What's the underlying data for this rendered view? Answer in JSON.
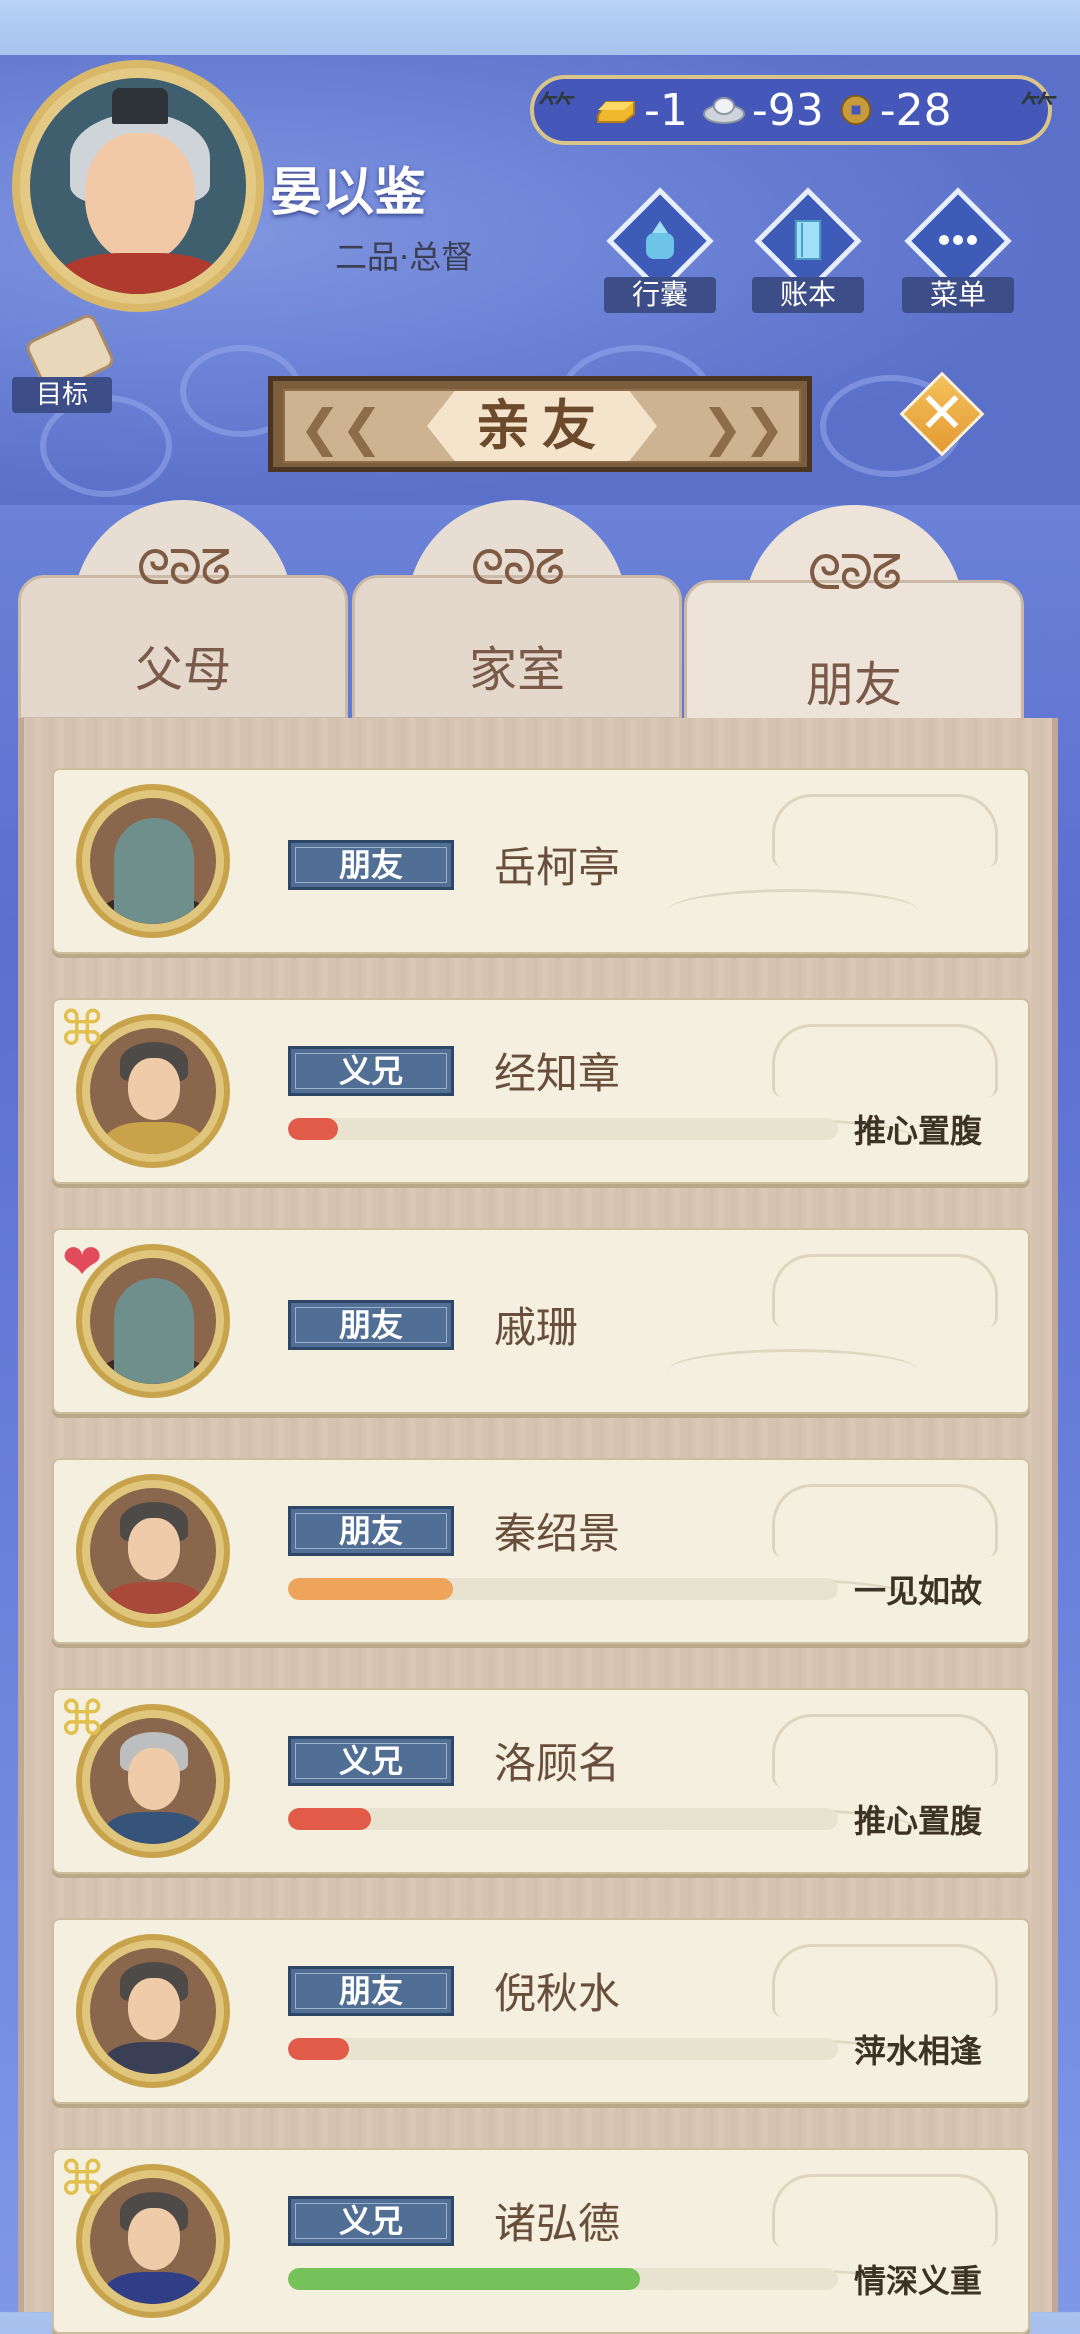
{
  "player": {
    "name": "晏以鉴",
    "rank": "二品·总督"
  },
  "currency": {
    "gold": "-1",
    "silver": "-93",
    "coin": "-28"
  },
  "top_buttons": [
    {
      "label": "行囊",
      "icon": "bag-icon"
    },
    {
      "label": "账本",
      "icon": "ledger-icon"
    },
    {
      "label": "菜单",
      "icon": "menu-dots-icon"
    }
  ],
  "goal": {
    "label": "目标"
  },
  "title": "亲友",
  "tabs": [
    {
      "label": "父母",
      "active": false
    },
    {
      "label": "家室",
      "active": false
    },
    {
      "label": "朋友",
      "active": true
    }
  ],
  "friends": [
    {
      "relation": "朋友",
      "name": "岳柯亭",
      "portrait": "gravestone",
      "badge": null
    },
    {
      "relation": "义兄",
      "name": "经知章",
      "portrait": "man-dark",
      "badge": "knot-icon",
      "bar_label": "推心置腹",
      "bar_color": "#e25a48",
      "bar_value": 0.09
    },
    {
      "relation": "朋友",
      "name": "戚珊",
      "portrait": "gravestone",
      "badge": "heart-icon"
    },
    {
      "relation": "朋友",
      "name": "秦绍景",
      "portrait": "man-dark",
      "badge": null,
      "bar_label": "一见如故",
      "bar_color": "#efa45c",
      "bar_value": 0.3
    },
    {
      "relation": "义兄",
      "name": "洛顾名",
      "portrait": "man-gray",
      "badge": "knot-icon",
      "bar_label": "推心置腹",
      "bar_color": "#e25a48",
      "bar_value": 0.15
    },
    {
      "relation": "朋友",
      "name": "倪秋水",
      "portrait": "woman",
      "badge": null,
      "bar_label": "萍水相逢",
      "bar_color": "#e25a48",
      "bar_value": 0.11
    },
    {
      "relation": "义兄",
      "name": "诸弘德",
      "portrait": "man-dark",
      "badge": "knot-icon",
      "bar_label": "情深义重",
      "bar_color": "#76c25a",
      "bar_value": 0.64
    }
  ]
}
